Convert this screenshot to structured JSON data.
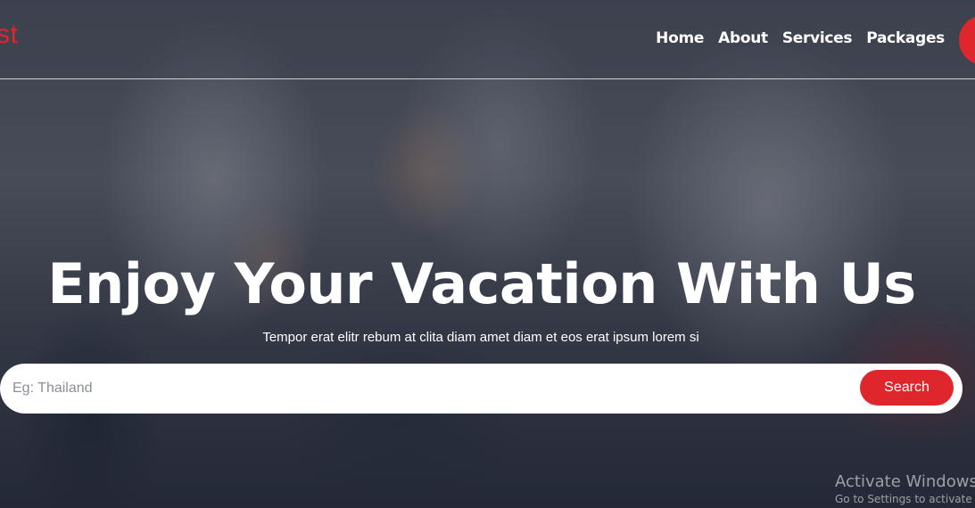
{
  "brand": {
    "logo_text": "st",
    "accent_color": "#e0262d"
  },
  "nav": {
    "items": [
      {
        "label": "Home"
      },
      {
        "label": "About"
      },
      {
        "label": "Services"
      },
      {
        "label": "Packages"
      }
    ]
  },
  "hero": {
    "title": "Enjoy Your Vacation With Us",
    "subtitle": "Tempor erat elitr rebum at clita diam amet diam et eos erat ipsum lorem si"
  },
  "search": {
    "placeholder": "Eg: Thailand",
    "button_label": "Search"
  },
  "watermark": {
    "title": "Activate Windows",
    "subtitle": "Go to Settings to activate Windows."
  }
}
